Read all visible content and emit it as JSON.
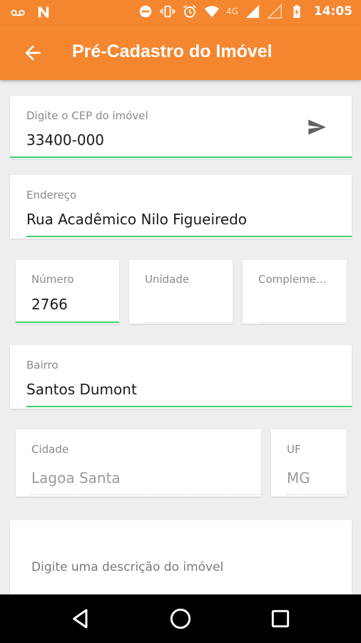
{
  "status_bar": {
    "time": "14:05",
    "network_type": "4G",
    "icons": [
      "voicemail-icon",
      "n-app-icon",
      "do-not-disturb-icon",
      "vibrate-icon",
      "alarm-icon",
      "wifi-icon",
      "signal-icon",
      "signal-empty-icon",
      "battery-charging-icon"
    ]
  },
  "app_bar": {
    "title": "Pré-Cadastro do Imóvel",
    "back_icon": "arrow-back-icon"
  },
  "form": {
    "cep": {
      "label": "Digite o CEP do imóvel",
      "value": "33400-000",
      "action_icon": "send-icon"
    },
    "endereco": {
      "label": "Endereço",
      "value": "Rua Acadêmico Nilo Figueiredo"
    },
    "numero": {
      "label": "Número",
      "value": "2766"
    },
    "unidade": {
      "label": "Unidade",
      "value": ""
    },
    "complemento": {
      "label": "Compleme…",
      "value": ""
    },
    "bairro": {
      "label": "Bairro",
      "value": "Santos Dumont"
    },
    "cidade": {
      "label": "Cidade",
      "value": "Lagoa Santa"
    },
    "uf": {
      "label": "UF",
      "value": "MG"
    },
    "descricao": {
      "placeholder": "Digite uma descrição do imóvel"
    }
  },
  "colors": {
    "primary": "#f4862f",
    "accent": "#3ecf6c",
    "background": "#eeeeee"
  },
  "nav_bar": {
    "icons": [
      "back-triangle-icon",
      "home-circle-icon",
      "recents-square-icon"
    ]
  }
}
